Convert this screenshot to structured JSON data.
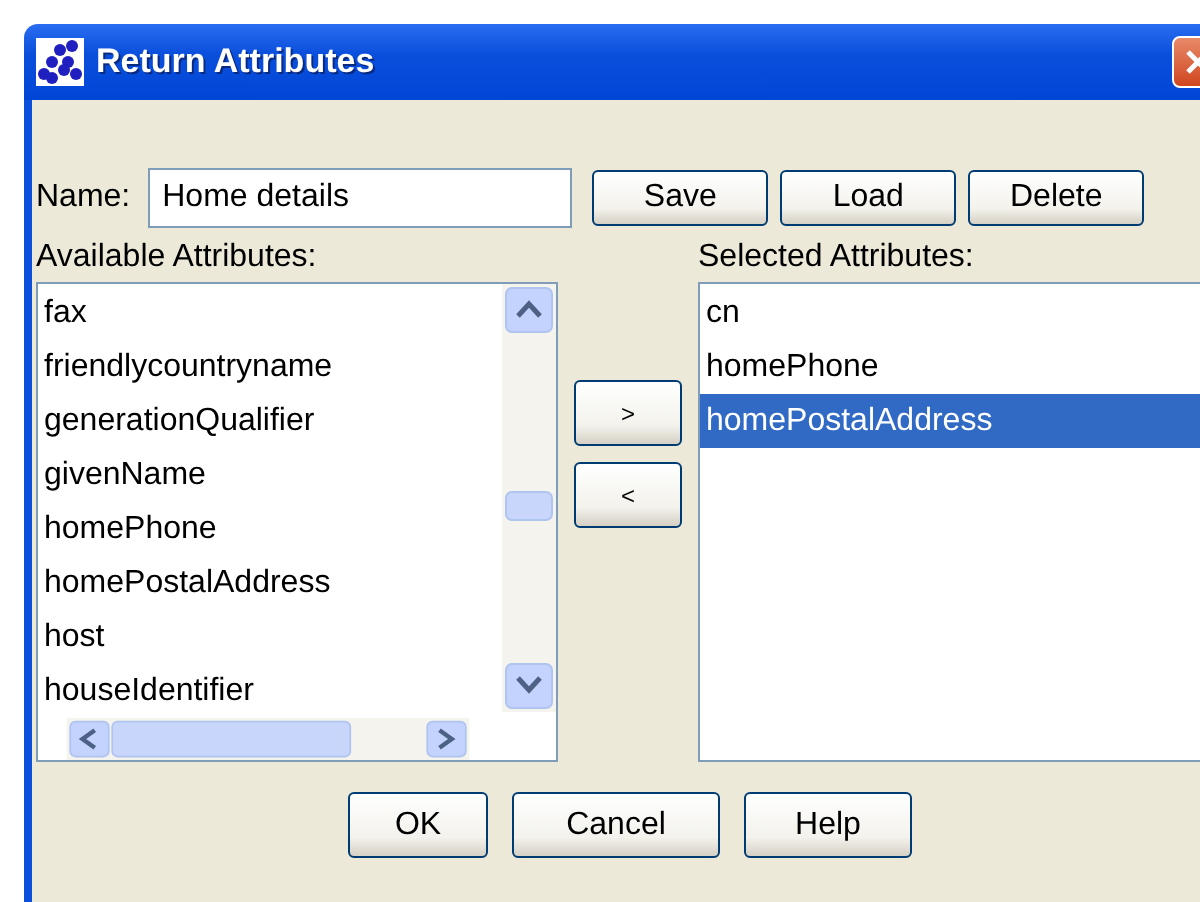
{
  "window": {
    "title": "Return Attributes"
  },
  "name_field": {
    "label": "Name:",
    "value": "Home details"
  },
  "name_buttons": [
    "Save",
    "Load",
    "Delete"
  ],
  "available": {
    "label": "Available Attributes:",
    "items": [
      {
        "text": "fax",
        "selected": false
      },
      {
        "text": "friendlycountryname",
        "selected": false
      },
      {
        "text": "generationQualifier",
        "selected": false
      },
      {
        "text": "givenName",
        "selected": false
      },
      {
        "text": "homePhone",
        "selected": false
      },
      {
        "text": "homePostalAddress",
        "selected": false
      },
      {
        "text": "host",
        "selected": false
      },
      {
        "text": "houseIdentifier",
        "selected": false
      }
    ]
  },
  "move_buttons": [
    ">",
    "<"
  ],
  "selected": {
    "label": "Selected Attributes:",
    "items": [
      {
        "text": "cn",
        "selected": false
      },
      {
        "text": "homePhone",
        "selected": false
      },
      {
        "text": "homePostalAddress",
        "selected": true
      }
    ]
  },
  "buttons": [
    "OK",
    "Cancel",
    "Help"
  ]
}
